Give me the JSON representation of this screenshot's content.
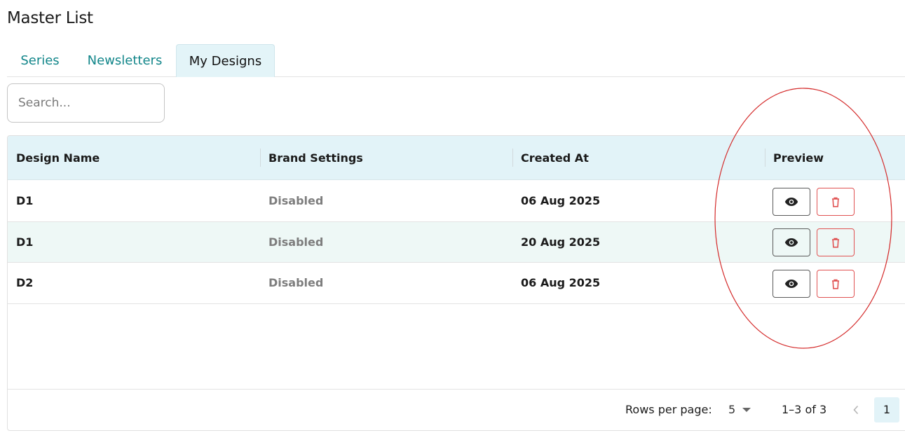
{
  "page": {
    "title": "Master List"
  },
  "tabs": [
    {
      "label": "Series",
      "active": false
    },
    {
      "label": "Newsletters",
      "active": false
    },
    {
      "label": "My Designs",
      "active": true
    }
  ],
  "search": {
    "placeholder": "Search...",
    "value": ""
  },
  "table": {
    "columns": [
      "Design Name",
      "Brand Settings",
      "Created At",
      "Preview"
    ],
    "rows": [
      {
        "design_name": "D1",
        "brand_settings": "Disabled",
        "created_at": "06 Aug 2025"
      },
      {
        "design_name": "D1",
        "brand_settings": "Disabled",
        "created_at": "20 Aug 2025"
      },
      {
        "design_name": "D2",
        "brand_settings": "Disabled",
        "created_at": "06 Aug 2025"
      }
    ],
    "row_actions": [
      {
        "icon": "eye-icon"
      },
      {
        "icon": "trash-icon"
      }
    ]
  },
  "pagination": {
    "rows_per_page_label": "Rows per page:",
    "rows_per_page": "5",
    "range": "1–3 of 3",
    "current_page": "1"
  },
  "colors": {
    "accent": "#12868a",
    "header_bg": "#e2f3f8",
    "row_highlight": "#eef8f6",
    "danger": "#e05252",
    "annotation": "#d42a2a"
  }
}
